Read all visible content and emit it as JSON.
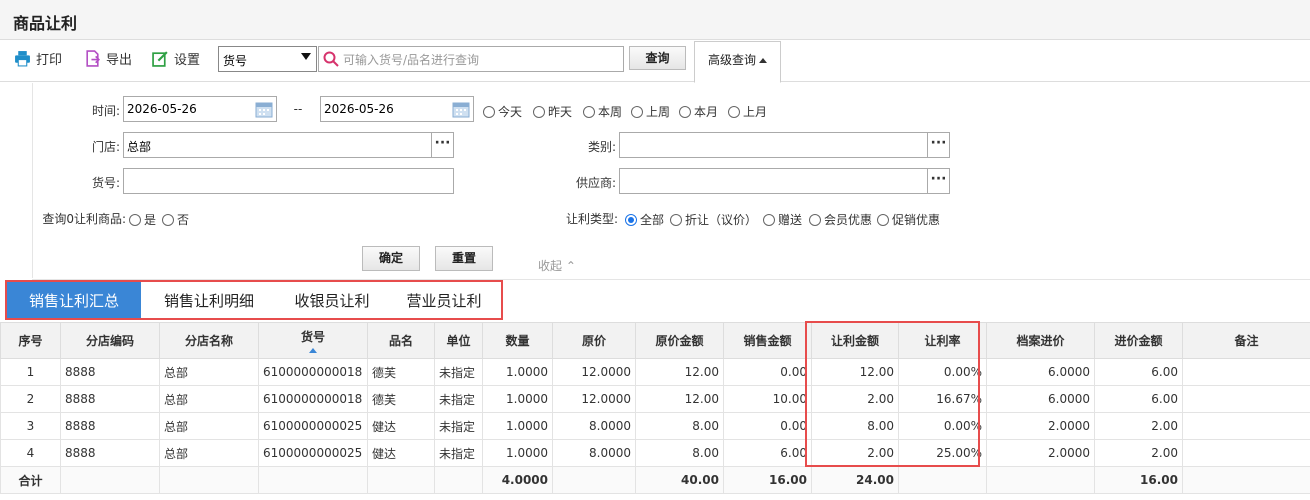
{
  "page": {
    "title": "商品让利"
  },
  "toolbar": {
    "print": "打印",
    "export": "导出",
    "settings": "设置",
    "select_value": "货号",
    "search_placeholder": "可输入货号/品名进行查询",
    "query": "查询",
    "advanced": "高级查询"
  },
  "filters": {
    "time_label": "时间:",
    "date_from": "2026-05-26",
    "date_sep": "--",
    "date_to": "2026-05-26",
    "period_options": [
      "今天",
      "昨天",
      "本周",
      "上周",
      "本月",
      "上月"
    ],
    "store_label": "门店:",
    "store_value": "总部",
    "category_label": "类别:",
    "category_value": "",
    "sku_label": "货号:",
    "sku_value": "",
    "supplier_label": "供应商:",
    "supplier_value": "",
    "zero_label": "查询0让利商品:",
    "zero_options": [
      "是",
      "否"
    ],
    "type_label": "让利类型:",
    "type_options": [
      "全部",
      "折让（议价）",
      "赠送",
      "会员优惠",
      "促销优惠"
    ],
    "type_selected": "全部",
    "confirm": "确定",
    "reset": "重置",
    "collapse": "收起"
  },
  "tabs": [
    {
      "label": "销售让利汇总",
      "active": true
    },
    {
      "label": "销售让利明细",
      "active": false
    },
    {
      "label": "收银员让利",
      "active": false
    },
    {
      "label": "营业员让利",
      "active": false
    }
  ],
  "table": {
    "headers": [
      "序号",
      "分店编码",
      "分店名称",
      "货号",
      "品名",
      "单位",
      "数量",
      "原价",
      "原价金额",
      "销售金额",
      "让利金额",
      "让利率",
      "档案进价",
      "进价金额",
      "备注"
    ],
    "rows": [
      [
        "1",
        "8888",
        "总部",
        "6100000000018",
        "德芙",
        "未指定",
        "1.0000",
        "12.0000",
        "12.00",
        "0.00",
        "12.00",
        "0.00%",
        "6.0000",
        "6.00",
        ""
      ],
      [
        "2",
        "8888",
        "总部",
        "6100000000018",
        "德芙",
        "未指定",
        "1.0000",
        "12.0000",
        "12.00",
        "10.00",
        "2.00",
        "16.67%",
        "6.0000",
        "6.00",
        ""
      ],
      [
        "3",
        "8888",
        "总部",
        "6100000000025",
        "健达",
        "未指定",
        "1.0000",
        "8.0000",
        "8.00",
        "0.00",
        "8.00",
        "0.00%",
        "2.0000",
        "2.00",
        ""
      ],
      [
        "4",
        "8888",
        "总部",
        "6100000000025",
        "健达",
        "未指定",
        "1.0000",
        "8.0000",
        "8.00",
        "6.00",
        "2.00",
        "25.00%",
        "2.0000",
        "2.00",
        ""
      ]
    ],
    "totals": [
      "合计",
      "",
      "",
      "",
      "",
      "",
      "4.0000",
      "",
      "40.00",
      "16.00",
      "24.00",
      "",
      "",
      "16.00",
      ""
    ]
  }
}
